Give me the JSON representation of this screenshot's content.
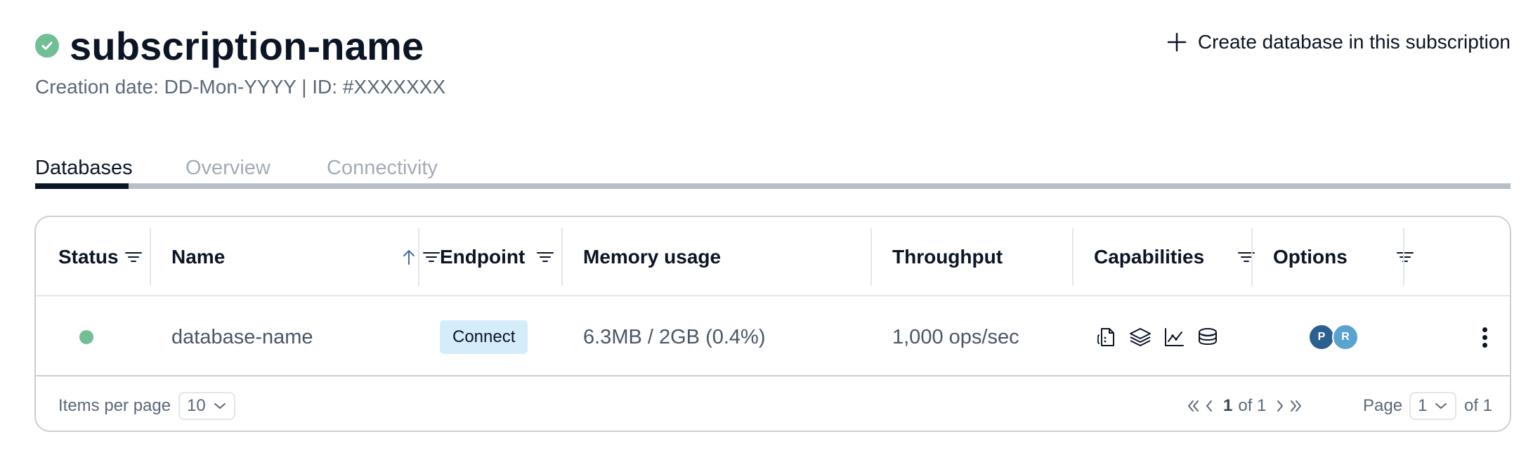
{
  "header": {
    "title": "subscription-name",
    "subtitle": "Creation date: DD-Mon-YYYY | ID: #XXXXXXX",
    "create_button_label": "Create database in this subscription"
  },
  "tabs": [
    {
      "label": "Databases",
      "active": true
    },
    {
      "label": "Overview",
      "active": false
    },
    {
      "label": "Connectivity",
      "active": false
    }
  ],
  "table": {
    "columns": {
      "status": "Status",
      "name": "Name",
      "endpoint": "Endpoint",
      "memory": "Memory usage",
      "throughput": "Throughput",
      "capabilities": "Capabilities",
      "options": "Options"
    },
    "rows": [
      {
        "status": "active",
        "name": "database-name",
        "endpoint_button": "Connect",
        "memory": "6.3MB / 2GB (0.4%)",
        "throughput": "1,000 ops/sec",
        "capabilities": [
          "json-doc-icon",
          "layers-icon",
          "timeseries-chart-icon",
          "database-stack-icon"
        ],
        "options": [
          {
            "initial": "P",
            "color": "#2a5f8f"
          },
          {
            "initial": "R",
            "color": "#5aa3cf"
          }
        ]
      }
    ]
  },
  "footer": {
    "items_per_page_label": "Items per page",
    "items_per_page_value": "10",
    "range_current": "1",
    "range_of": "of 1",
    "page_label": "Page",
    "page_value": "1",
    "page_total": "of 1"
  },
  "colors": {
    "status_green": "#72bf96",
    "title_text": "#0b1526",
    "muted_text": "#5b6878",
    "tab_inactive": "#a3acb6",
    "connect_bg": "#d5ecfa",
    "sort_arrow": "#3f6fb3"
  }
}
